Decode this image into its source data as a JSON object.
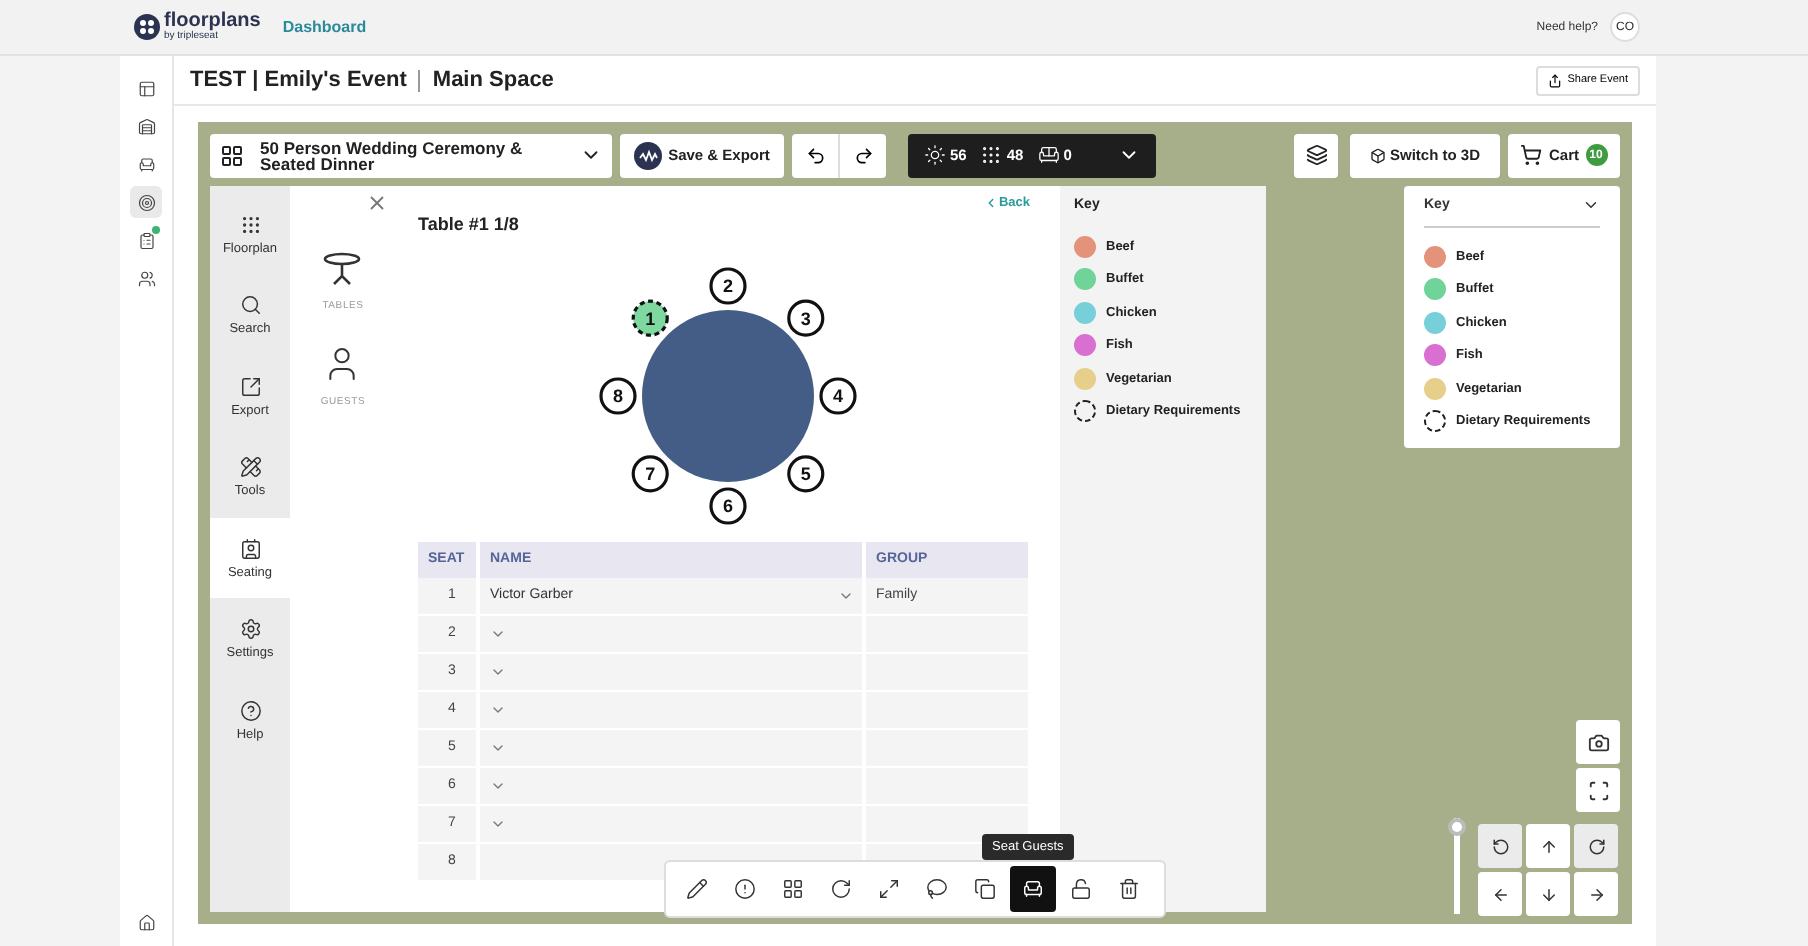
{
  "header": {
    "brand": "floorplans",
    "brand_sub": "by tripleseat",
    "nav_link": "Dashboard",
    "help": "Need help?",
    "avatar": "CO"
  },
  "rail": [
    {
      "kind": "layout",
      "selected": false,
      "dot": false
    },
    {
      "kind": "venue",
      "selected": false,
      "dot": false
    },
    {
      "kind": "chair",
      "selected": false,
      "dot": false
    },
    {
      "kind": "target",
      "selected": true,
      "dot": false
    },
    {
      "kind": "clipboard",
      "selected": false,
      "dot": true
    },
    {
      "kind": "people",
      "selected": false,
      "dot": false
    }
  ],
  "title": {
    "event": "TEST | Emily's Event",
    "space": "Main Space",
    "share": "Share Event"
  },
  "toolbar": {
    "layout_select": "50 Person Wedding Ceremony & Seated Dinner",
    "save": "Save & Export",
    "stats": [
      {
        "kind": "tables",
        "value": "56"
      },
      {
        "kind": "chairs",
        "value": "48"
      },
      {
        "kind": "sofas",
        "value": "0"
      }
    ],
    "switch_3d": "Switch to 3D",
    "cart": "Cart",
    "cart_count": "10"
  },
  "nav": [
    {
      "kind": "floorplan",
      "label": "Floorplan",
      "selected": false
    },
    {
      "kind": "search",
      "label": "Search",
      "selected": false
    },
    {
      "kind": "export",
      "label": "Export",
      "selected": false
    },
    {
      "kind": "tools",
      "label": "Tools",
      "selected": false
    },
    {
      "kind": "seating",
      "label": "Seating",
      "selected": true
    },
    {
      "kind": "settings",
      "label": "Settings",
      "selected": false
    },
    {
      "kind": "help",
      "label": "Help",
      "selected": false
    }
  ],
  "tabs": [
    {
      "kind": "tables",
      "label": "TABLES"
    },
    {
      "kind": "guests",
      "label": "GUESTS"
    }
  ],
  "seating": {
    "title": "Table #1 1/8",
    "back": "Back",
    "seats": [
      {
        "label": "1",
        "selected": true
      },
      {
        "label": "2",
        "selected": false
      },
      {
        "label": "3",
        "selected": false
      },
      {
        "label": "4",
        "selected": false
      },
      {
        "label": "5",
        "selected": false
      },
      {
        "label": "6",
        "selected": false
      },
      {
        "label": "7",
        "selected": false
      },
      {
        "label": "8",
        "selected": false
      }
    ],
    "columns": [
      "SEAT",
      "NAME",
      "GROUP"
    ],
    "rows": [
      {
        "seat": "1",
        "name": "Victor Garber",
        "group": "Family"
      },
      {
        "seat": "2"
      },
      {
        "seat": "3"
      },
      {
        "seat": "4"
      },
      {
        "seat": "5"
      },
      {
        "seat": "6"
      },
      {
        "seat": "7"
      },
      {
        "seat": "8"
      }
    ]
  },
  "key": {
    "title": "Key",
    "items": [
      {
        "label": "Beef",
        "kind": "swatch",
        "color": "#e4937a"
      },
      {
        "label": "Buffet",
        "kind": "swatch",
        "color": "#6fd39a"
      },
      {
        "label": "Chicken",
        "kind": "swatch",
        "color": "#77cfd9"
      },
      {
        "label": "Fish",
        "kind": "swatch",
        "color": "#d96fd0"
      },
      {
        "label": "Vegetarian",
        "kind": "swatch",
        "color": "#e6cf8a"
      },
      {
        "label": "Dietary Requirements",
        "kind": "dashed"
      }
    ]
  },
  "key_card": {
    "title": "Key",
    "items": [
      {
        "label": "Beef",
        "kind": "swatch",
        "color": "#e4937a"
      },
      {
        "label": "Buffet",
        "kind": "swatch",
        "color": "#6fd39a"
      },
      {
        "label": "Chicken",
        "kind": "swatch",
        "color": "#77cfd9"
      },
      {
        "label": "Fish",
        "kind": "swatch",
        "color": "#d96fd0"
      },
      {
        "label": "Vegetarian",
        "kind": "swatch",
        "color": "#e6cf8a"
      },
      {
        "label": "Dietary Requirements",
        "kind": "dashed"
      }
    ]
  },
  "tools": [
    {
      "kind": "pencil",
      "selected": false
    },
    {
      "kind": "alert",
      "selected": false
    },
    {
      "kind": "group",
      "selected": false
    },
    {
      "kind": "rotate",
      "selected": false
    },
    {
      "kind": "resize",
      "selected": false
    },
    {
      "kind": "lasso",
      "selected": false
    },
    {
      "kind": "copy",
      "selected": false
    },
    {
      "kind": "seat",
      "selected": true
    },
    {
      "kind": "unlock",
      "selected": false
    },
    {
      "kind": "trash",
      "selected": false
    }
  ],
  "tooltip": "Seat Guests",
  "zoom": {
    "level": 1
  }
}
